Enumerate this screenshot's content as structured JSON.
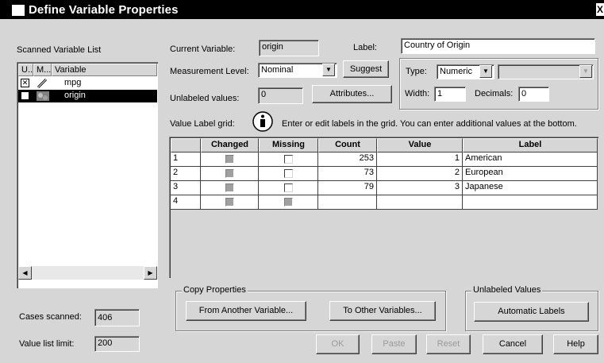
{
  "window": {
    "title": "Define Variable Properties",
    "close_glyph": "X"
  },
  "left_panel": {
    "scanned_list_label": "Scanned Variable List",
    "columns": [
      "U...",
      "M...",
      "Variable"
    ],
    "variables": [
      {
        "checked": true,
        "measure_icon": "ruler-icon",
        "name": "mpg",
        "selected": false
      },
      {
        "checked": false,
        "measure_icon": "bar-chart-icon",
        "name": "origin",
        "selected": true
      }
    ],
    "cases_scanned_label": "Cases scanned:",
    "cases_scanned_value": "406",
    "value_list_limit_label": "Value list limit:",
    "value_list_limit_value": "200"
  },
  "properties": {
    "current_variable_label": "Current Variable:",
    "current_variable_value": "origin",
    "label_label": "Label:",
    "label_value": "Country of Origin",
    "measurement_level_label": "Measurement Level:",
    "measurement_level_value": "Nominal",
    "suggest_button": "Suggest",
    "type_label": "Type:",
    "type_value": "Numeric",
    "type_extra_value": "",
    "unlabeled_values_label": "Unlabeled values:",
    "unlabeled_values_value": "0",
    "attributes_button": "Attributes...",
    "width_label": "Width:",
    "width_value": "1",
    "decimals_label": "Decimals:",
    "decimals_value": "0"
  },
  "value_label_grid": {
    "label": "Value Label grid:",
    "info_text": "Enter or edit labels in the grid.  You can enter additional values at the bottom.",
    "columns": [
      "Changed",
      "Missing",
      "Count",
      "Value",
      "Label"
    ],
    "rows": [
      {
        "num": "1",
        "count": "253",
        "value": "1",
        "label": "American"
      },
      {
        "num": "2",
        "count": "73",
        "value": "2",
        "label": "European"
      },
      {
        "num": "3",
        "count": "79",
        "value": "3",
        "label": "Japanese"
      },
      {
        "num": "4",
        "count": "",
        "value": "",
        "label": ""
      }
    ]
  },
  "copy_properties": {
    "group_label": "Copy Properties",
    "from_button": "From Another Variable...",
    "to_button": "To Other Variables..."
  },
  "unlabeled_values_group": {
    "group_label": "Unlabeled Values",
    "automatic_labels_button": "Automatic Labels"
  },
  "footer_buttons": {
    "ok": "OK",
    "paste": "Paste",
    "reset": "Reset",
    "cancel": "Cancel",
    "help": "Help"
  },
  "colors": {
    "title_bg": "#000000",
    "dialog_bg": "#d6d6d6",
    "selection_bg": "#000000"
  }
}
